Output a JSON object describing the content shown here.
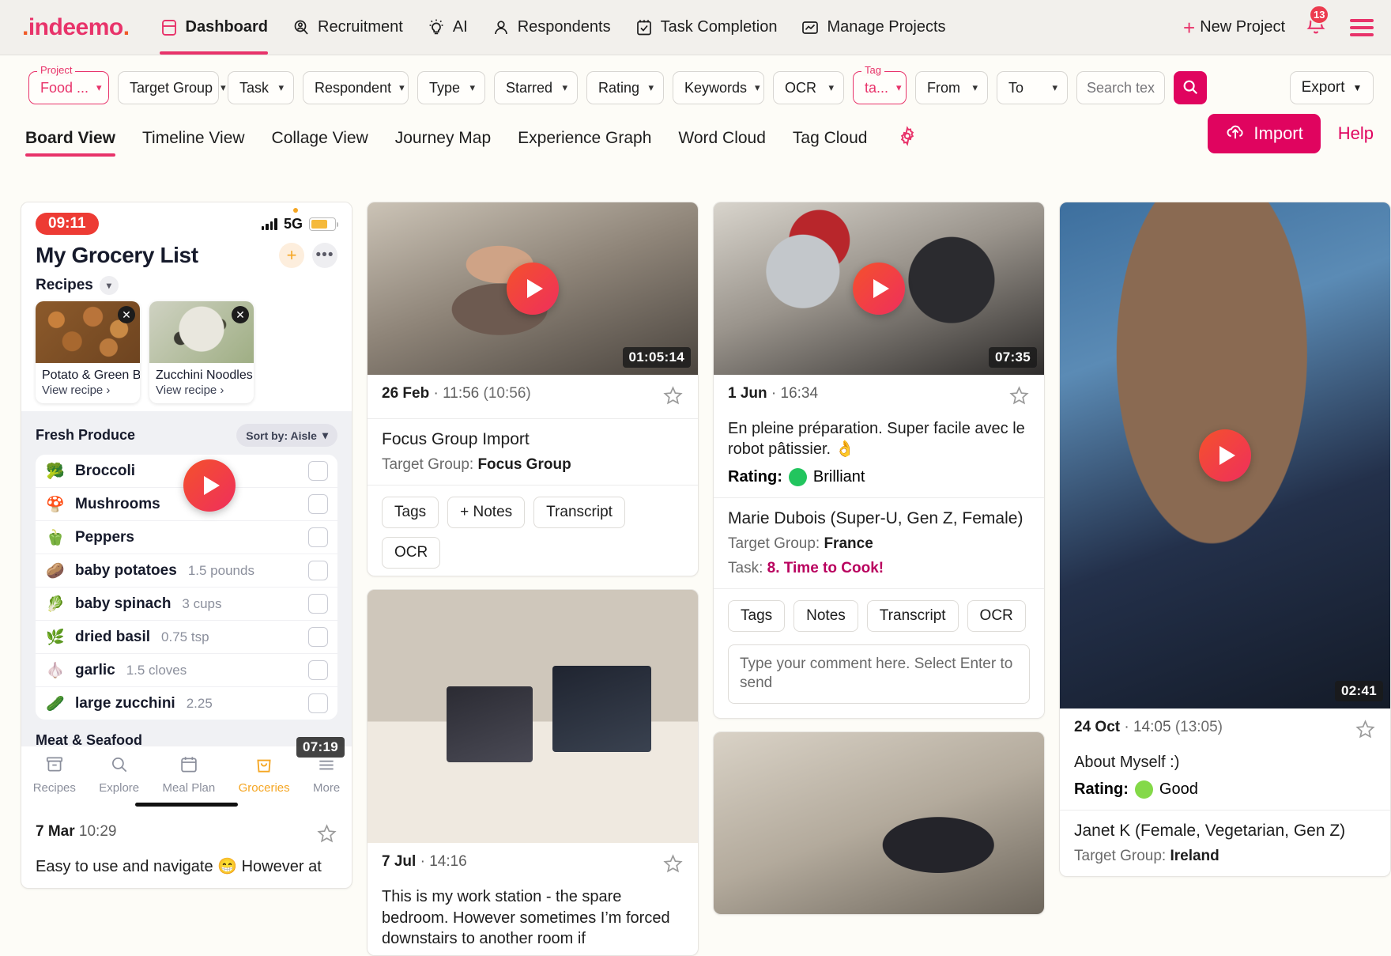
{
  "brand": {
    "logo": "indeemo",
    "accent": "#e0045f",
    "accent2": "#e8336a"
  },
  "topnav": {
    "items": [
      {
        "label": "Dashboard",
        "icon": "dashboard-icon",
        "active": true
      },
      {
        "label": "Recruitment",
        "icon": "recruitment-icon",
        "active": false
      },
      {
        "label": "AI",
        "icon": "ai-bulb-icon",
        "active": false
      },
      {
        "label": "Respondents",
        "icon": "respondents-icon",
        "active": false
      },
      {
        "label": "Task Completion",
        "icon": "task-completion-icon",
        "active": false
      },
      {
        "label": "Manage Projects",
        "icon": "manage-projects-icon",
        "active": false
      }
    ],
    "new_project": "New Project",
    "notification_count": "13"
  },
  "filters": {
    "project": {
      "float_label": "Project",
      "value": "Food ..."
    },
    "target_group": "Target Group",
    "task": "Task",
    "respondent": "Respondent",
    "type": "Type",
    "starred": "Starred",
    "rating": "Rating",
    "keywords": "Keywords",
    "ocr": "OCR",
    "tag": {
      "float_label": "Tag",
      "value": "ta..."
    },
    "from": "From",
    "to": "To",
    "search_placeholder": "Search text",
    "search_value": "",
    "export": "Export"
  },
  "tabs": {
    "items": [
      {
        "label": "Board View",
        "active": true
      },
      {
        "label": "Timeline View",
        "active": false
      },
      {
        "label": "Collage View",
        "active": false
      },
      {
        "label": "Journey Map",
        "active": false
      },
      {
        "label": "Experience Graph",
        "active": false
      },
      {
        "label": "Word Cloud",
        "active": false
      },
      {
        "label": "Tag Cloud",
        "active": false
      }
    ],
    "settings_icon": "gear-icon",
    "import": "Import",
    "help": "Help"
  },
  "phone_card": {
    "status_time": "09:11",
    "network": "5G",
    "title": "My Grocery List",
    "recipes_label": "Recipes",
    "recipes": [
      {
        "name": "Potato & Green Be...",
        "link": "View recipe"
      },
      {
        "name": "Zucchini Noodles...",
        "link": "View recipe"
      }
    ],
    "section": "Fresh Produce",
    "sort_by": "Sort by: Aisle",
    "items": [
      {
        "emoji": "🥦",
        "name": "Broccoli",
        "qty": ""
      },
      {
        "emoji": "🍄",
        "name": "Mushrooms",
        "qty": ""
      },
      {
        "emoji": "🫑",
        "name": "Peppers",
        "qty": ""
      },
      {
        "emoji": "🥔",
        "name": "baby potatoes",
        "qty": "1.5 pounds"
      },
      {
        "emoji": "🥬",
        "name": "baby spinach",
        "qty": "3 cups"
      },
      {
        "emoji": "🌿",
        "name": "dried basil",
        "qty": "0.75 tsp"
      },
      {
        "emoji": "🧄",
        "name": "garlic",
        "qty": "1.5 cloves"
      },
      {
        "emoji": "🥒",
        "name": "large zucchini",
        "qty": "2.25"
      }
    ],
    "next_section": "Meat & Seafood",
    "tabbar": [
      {
        "label": "Recipes",
        "active": false
      },
      {
        "label": "Explore",
        "active": false
      },
      {
        "label": "Meal Plan",
        "active": false
      },
      {
        "label": "Groceries",
        "active": true
      },
      {
        "label": "More",
        "active": false
      }
    ],
    "duration": "07:19"
  },
  "phone_card_footer": {
    "date": "7 Mar",
    "time": "10:29",
    "comment": "Easy to use and navigate 😁 However at"
  },
  "card_focus_group": {
    "duration": "01:05:14",
    "date": "26 Feb",
    "time": "11:56",
    "local_time": "(10:56)",
    "title": "Focus Group Import",
    "target_group_label": "Target Group:",
    "target_group_value": "Focus Group",
    "chips": [
      "Tags",
      "+ Notes",
      "Transcript",
      "OCR"
    ]
  },
  "card_workstation": {
    "date": "7 Jul",
    "time": "14:16",
    "comment": "This is my work station - the spare bedroom. However sometimes I’m forced downstairs to another room if"
  },
  "card_marie": {
    "duration": "07:35",
    "date": "1 Jun",
    "time": "16:34",
    "comment": "En pleine préparation. Super facile avec le robot pâtissier. 👌",
    "rating_label": "Rating:",
    "rating_value": "Brilliant",
    "rating_color": "#22c55e",
    "respondent": "Marie Dubois (Super-U, Gen Z, Female)",
    "target_group_label": "Target Group:",
    "target_group_value": "France",
    "task_label": "Task:",
    "task_value": "8. Time to Cook!",
    "chips": [
      "Tags",
      "Notes",
      "Transcript",
      "OCR"
    ],
    "comment_placeholder": "Type your comment here. Select Enter to send"
  },
  "card_janet": {
    "duration": "02:41",
    "date": "24 Oct",
    "time": "14:05",
    "local_time": "(13:05)",
    "comment": "About Myself :)",
    "rating_label": "Rating:",
    "rating_value": "Good",
    "rating_color": "#84d948",
    "respondent": "Janet K (Female, Vegetarian, Gen Z)",
    "target_group_label": "Target Group:",
    "target_group_value": "Ireland"
  }
}
